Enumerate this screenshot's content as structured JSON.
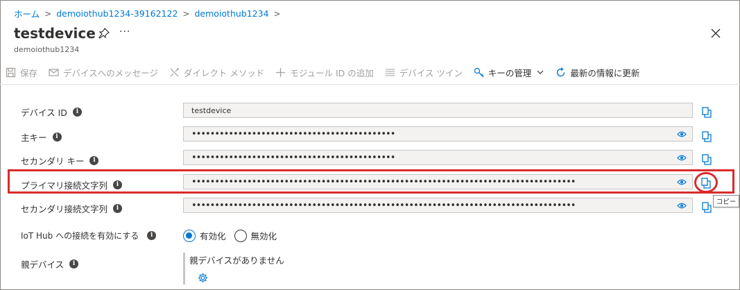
{
  "breadcrumb": {
    "items": [
      "ホーム",
      "demoiothub1234-39162122",
      "demoiothub1234"
    ],
    "separator": ">"
  },
  "header": {
    "title": "testdevice",
    "subtitle": "demoiothub1234",
    "more": "···"
  },
  "toolbar": {
    "save": "保存",
    "message": "デバイスへのメッセージ",
    "direct_method": "ダイレクト メソッド",
    "add_module": "モジュール ID の追加",
    "device_twin": "デバイス ツイン",
    "manage_keys": "キーの管理",
    "refresh": "最新の情報に更新"
  },
  "fields": {
    "device_id": {
      "label": "デバイス ID",
      "value": "testdevice"
    },
    "primary_key": {
      "label": "主キー",
      "value": "••••••••••••••••••••••••••••••••••••••••••••"
    },
    "secondary_key": {
      "label": "セカンダリ キー",
      "value": "••••••••••••••••••••••••••••••••••••••••••••"
    },
    "primary_conn": {
      "label": "プライマリ接続文字列",
      "value": "••••••••••••••••••••••••••••••••••••••••••••••••••••••••••••••••••••••••••••••••••••••••••••••••••••••••••••••••••••••••••••••••••••"
    },
    "secondary_conn": {
      "label": "セカンダリ接続文字列",
      "value": "••••••••••••••••••••••••••••••••••••••••••••••••••••••••••••••••••••••••••••••••••••••••••••••••••••••••••••••••••••••••••••••••••••"
    }
  },
  "connection": {
    "label": "IoT Hub への接続を有効にする",
    "enabled": "有効化",
    "disabled": "無効化",
    "selected": "有効化"
  },
  "parent": {
    "label": "親デバイス",
    "empty_text": "親デバイスがありません"
  },
  "tooltip": {
    "copy": "コピー"
  },
  "info_glyph": "i",
  "colors": {
    "accent": "#0078d4",
    "highlight": "#d92b2b",
    "disabled_text": "#a19f9d"
  }
}
